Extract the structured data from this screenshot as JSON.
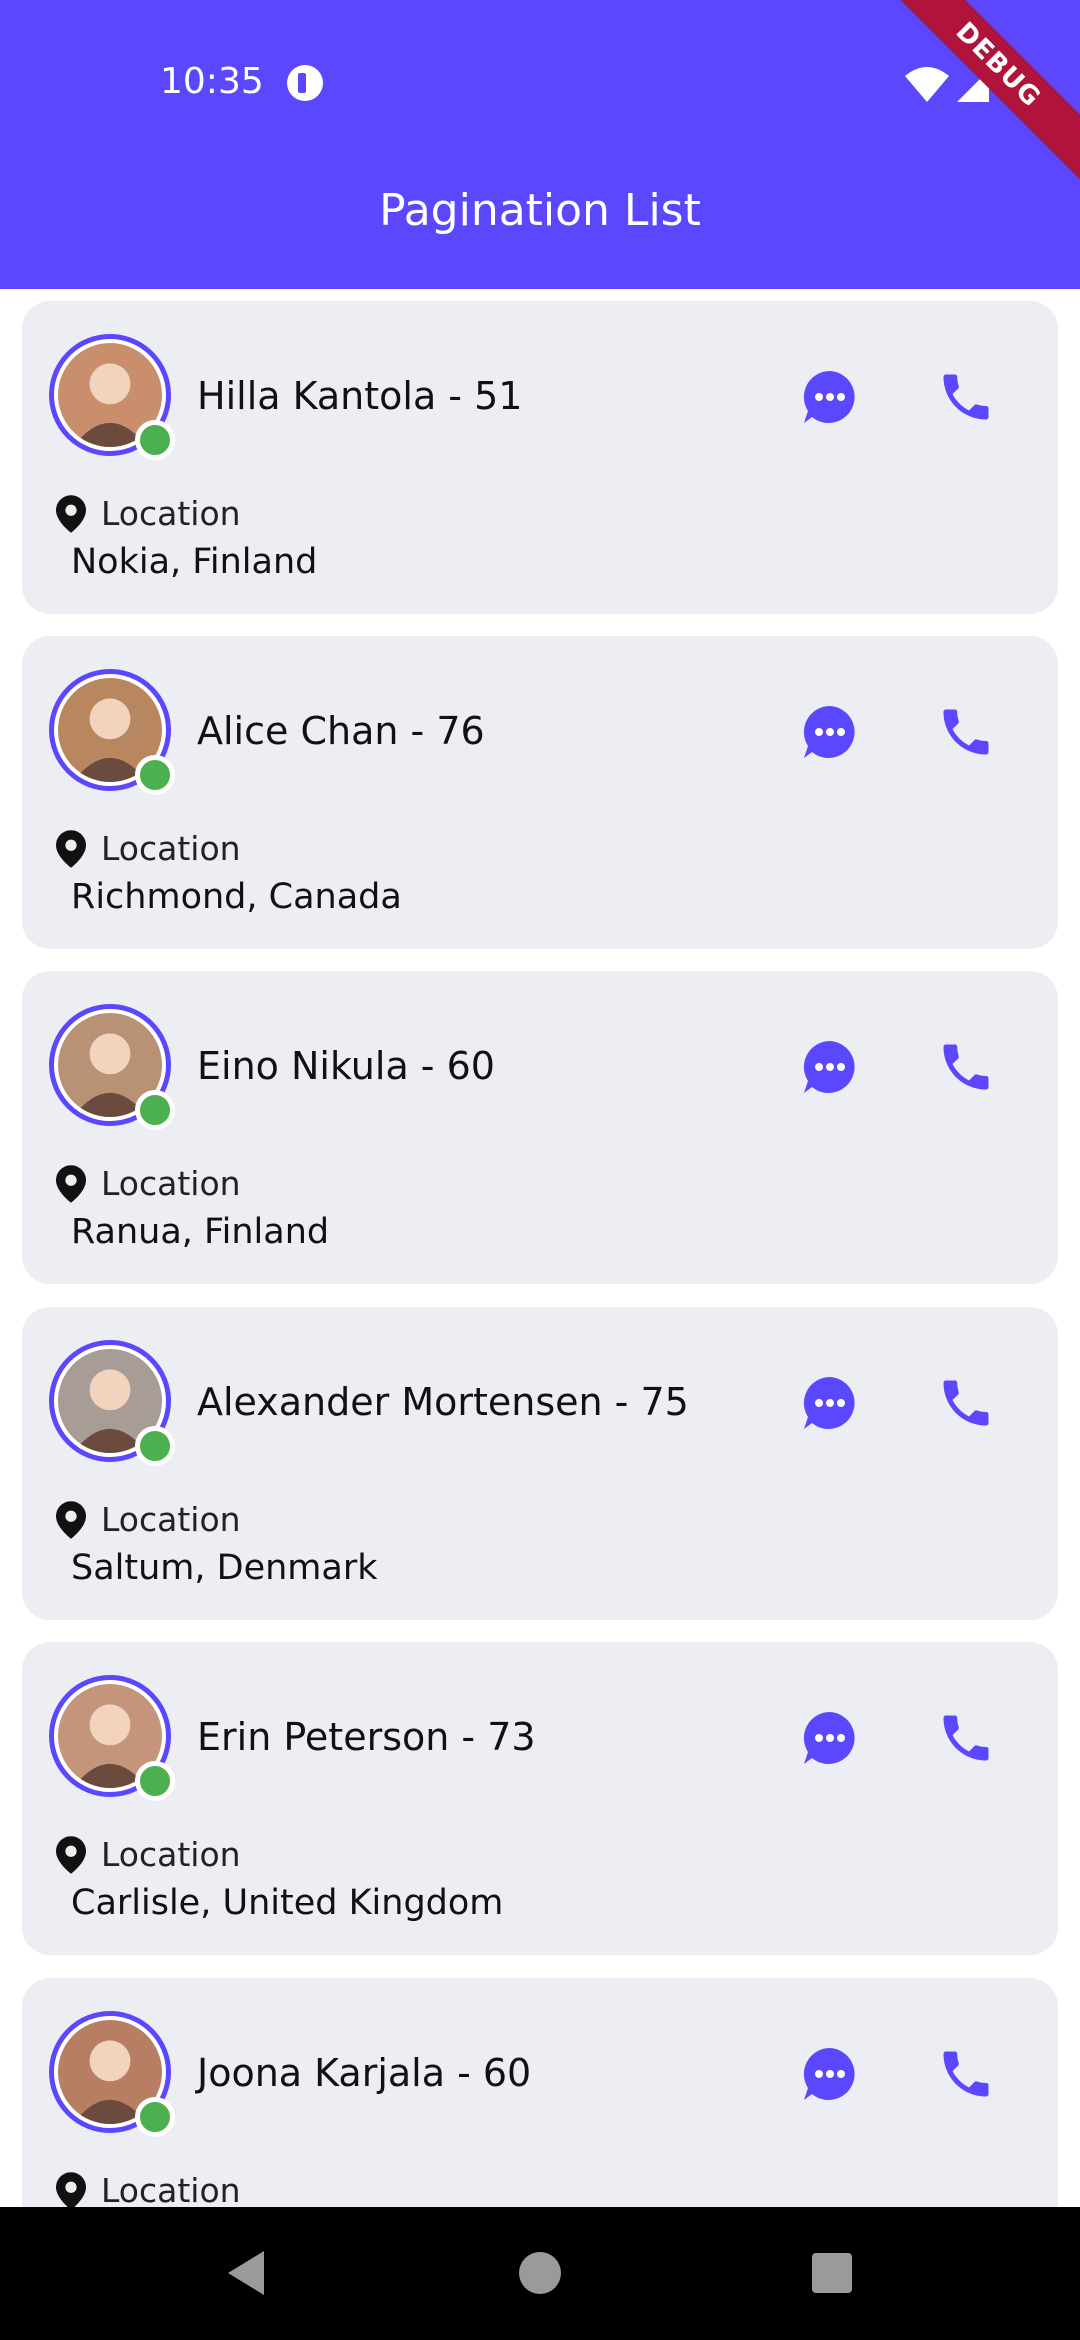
{
  "status_bar": {
    "time": "10:35",
    "app_icon": "app-notification-icon",
    "icons": [
      "wifi-icon",
      "cell-signal-icon",
      "battery-icon"
    ]
  },
  "debug_banner": "DEBUG",
  "app_bar": {
    "title": "Pagination List"
  },
  "theme": {
    "primary": "#5A47FE",
    "card_bg": "#EDEDF4",
    "online": "#4CAF50"
  },
  "contacts": [
    {
      "name": "Hilla Kantola - 51",
      "location_label": "Location",
      "location": "Nokia, Finland",
      "online": true
    },
    {
      "name": "Alice Chan - 76",
      "location_label": "Location",
      "location": "Richmond, Canada",
      "online": true
    },
    {
      "name": "Eino Nikula - 60",
      "location_label": "Location",
      "location": "Ranua, Finland",
      "online": true
    },
    {
      "name": "Alexander Mortensen - 75",
      "location_label": "Location",
      "location": "Saltum, Denmark",
      "online": true
    },
    {
      "name": "Erin Peterson - 73",
      "location_label": "Location",
      "location": "Carlisle, United Kingdom",
      "online": true
    },
    {
      "name": "Joona Karjala - 60",
      "location_label": "Location",
      "location": "",
      "online": true
    }
  ],
  "nav": {
    "buttons": [
      "back-icon",
      "home-icon",
      "recents-icon"
    ]
  }
}
